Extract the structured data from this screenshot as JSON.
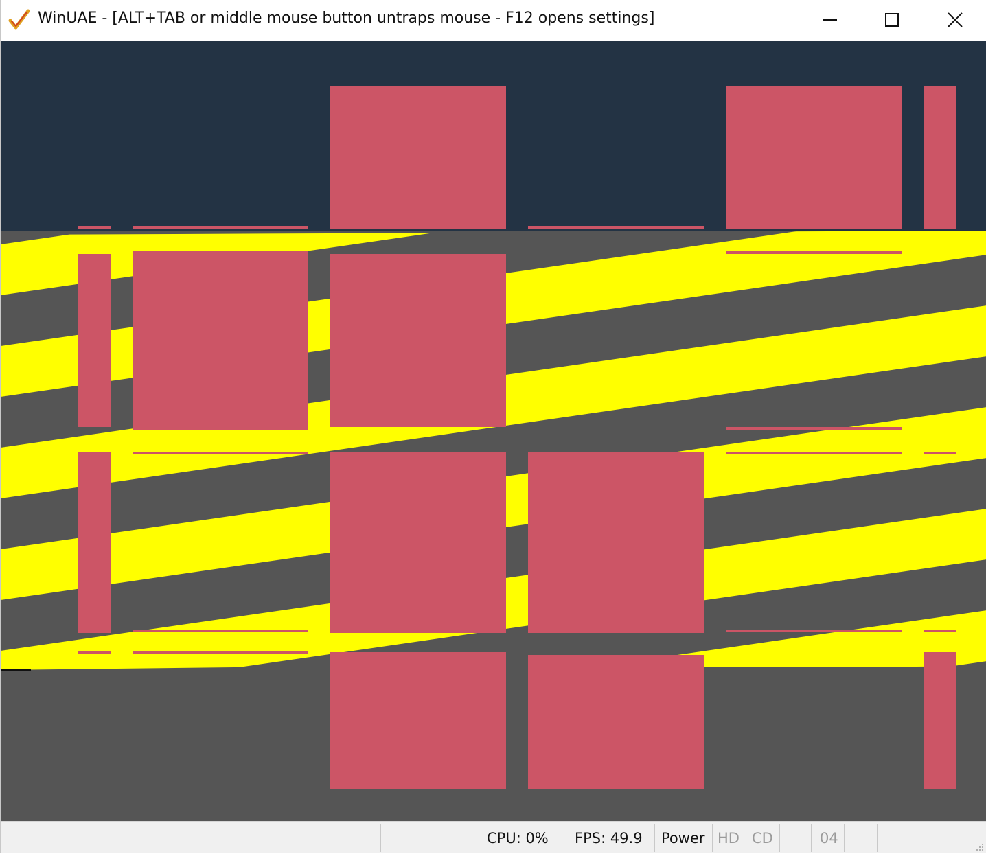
{
  "window": {
    "title": "WinUAE - [ALT+TAB or middle mouse button untraps mouse - F12 opens settings]",
    "icons": {
      "app": "winuae-checkmark-icon",
      "minimize": "minimize-icon",
      "maximize": "maximize-icon",
      "close": "close-icon"
    }
  },
  "colors": {
    "sky": "#233344",
    "ground": "#555555",
    "stripe": "#ffff00",
    "block": "#cc5566"
  },
  "statusbar": {
    "cpu": "CPU: 0%",
    "fps": "FPS: 49.9",
    "power": "Power",
    "hd": "HD",
    "cd": "CD",
    "drive_counter": "04"
  }
}
